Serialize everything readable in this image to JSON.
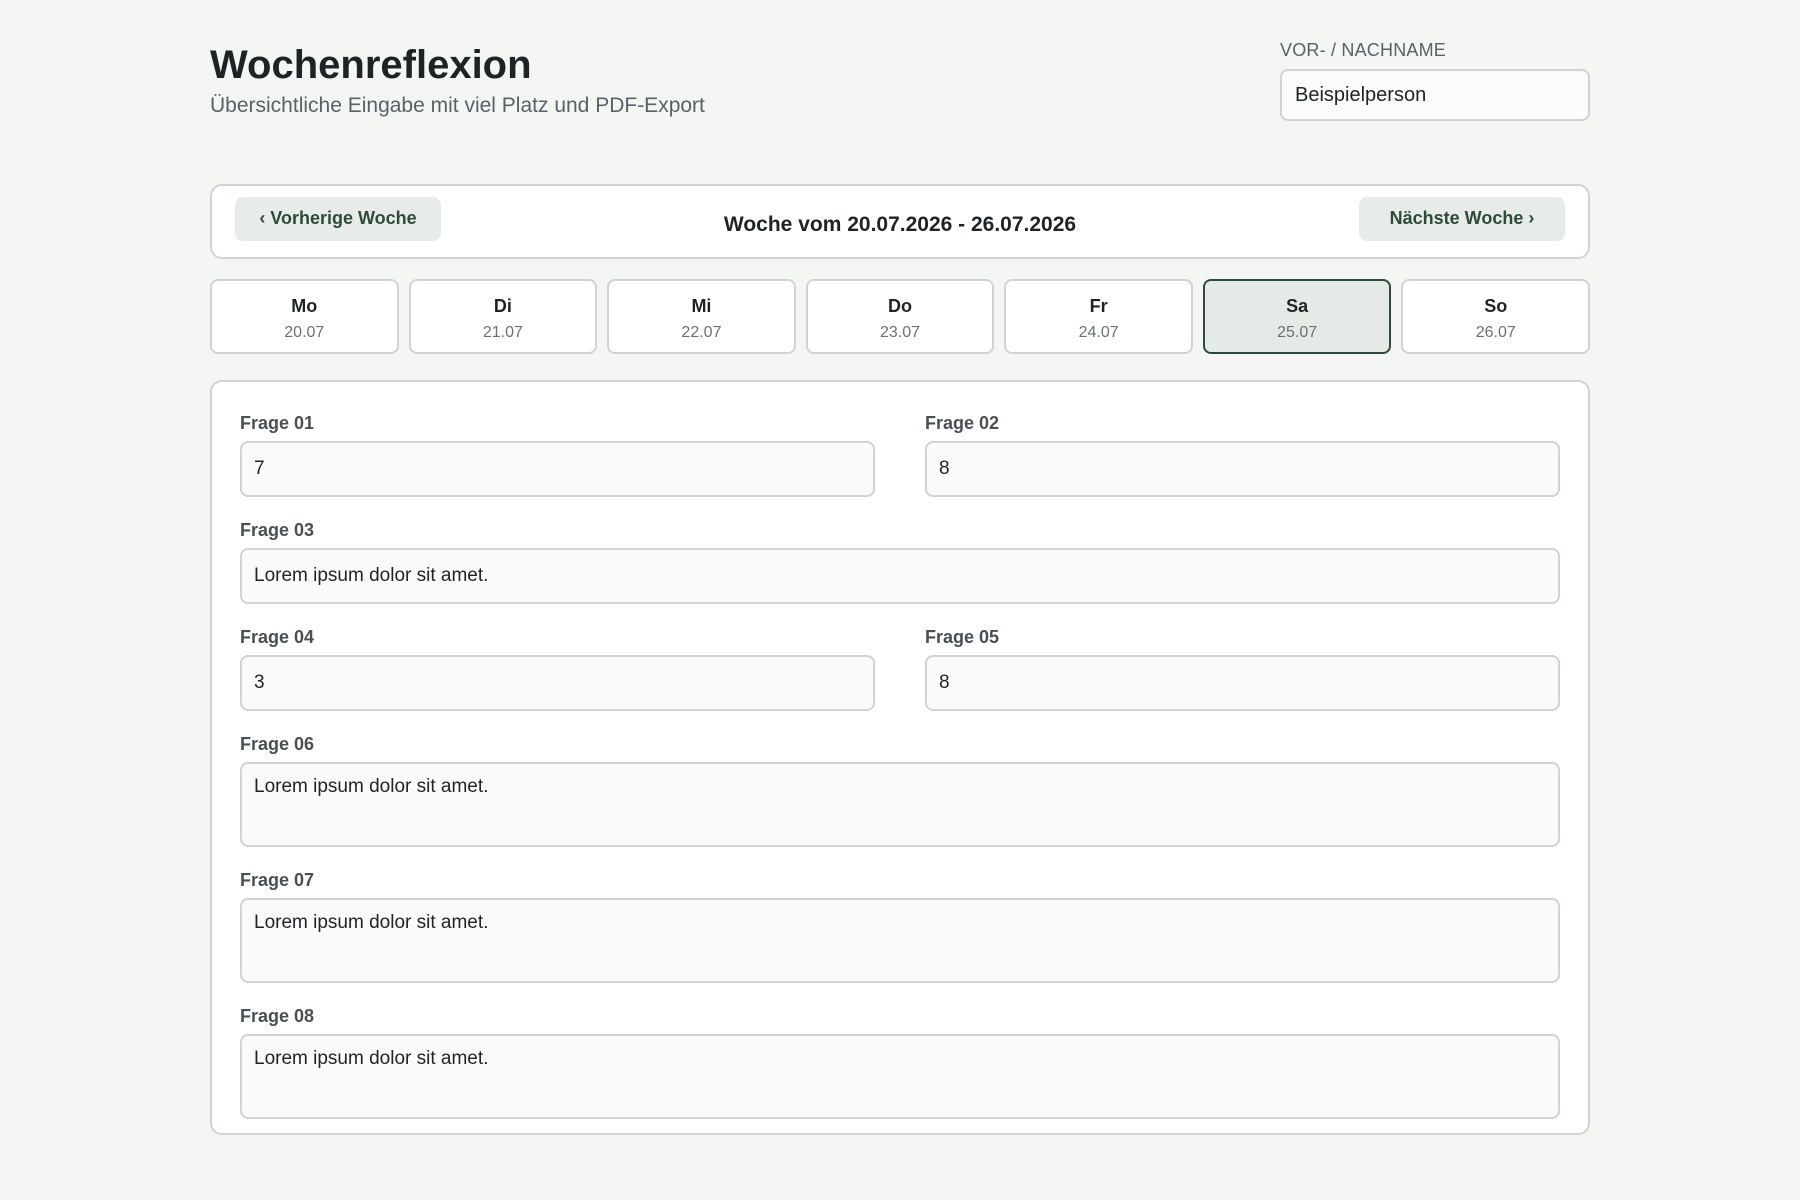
{
  "header": {
    "title": "Wochenreflexion",
    "subtitle": "Übersichtliche Eingabe mit viel Platz und PDF-Export",
    "name_label": "VOR- / NACHNAME",
    "name_value": "Beispielperson"
  },
  "week_nav": {
    "prev_label": "‹ Vorherige Woche",
    "next_label": "Nächste Woche ›",
    "week_label": "Woche vom 20.07.2026 - 26.07.2026"
  },
  "days": [
    {
      "name": "Mo",
      "date": "20.07"
    },
    {
      "name": "Di",
      "date": "21.07"
    },
    {
      "name": "Mi",
      "date": "22.07"
    },
    {
      "name": "Do",
      "date": "23.07"
    },
    {
      "name": "Fr",
      "date": "24.07"
    },
    {
      "name": "Sa",
      "date": "25.07"
    },
    {
      "name": "So",
      "date": "26.07"
    }
  ],
  "selected_day": "Sa",
  "questions": [
    {
      "label": "Frage 01",
      "value": "7"
    },
    {
      "label": "Frage 02",
      "value": "8"
    },
    {
      "label": "Frage 03",
      "value": "Lorem ipsum dolor sit amet."
    },
    {
      "label": "Frage 04",
      "value": "3"
    },
    {
      "label": "Frage 05",
      "value": "8"
    },
    {
      "label": "Frage 06",
      "value": "Lorem ipsum dolor sit amet."
    },
    {
      "label": "Frage 07",
      "value": "Lorem ipsum dolor sit amet."
    },
    {
      "label": "Frage 08",
      "value": "Lorem ipsum dolor sit amet."
    }
  ]
}
